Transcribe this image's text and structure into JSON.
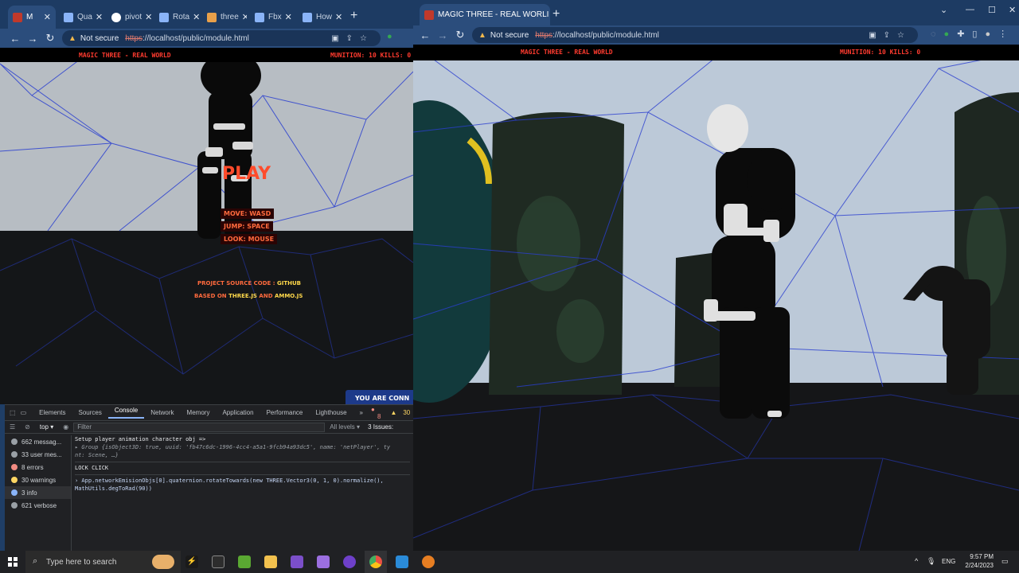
{
  "left_window": {
    "tabs": [
      {
        "label": "M",
        "color": "#c0392b"
      },
      {
        "label": "Qua",
        "color": "#8ab4f8"
      },
      {
        "label": "pivot",
        "color": "#ffffff"
      },
      {
        "label": "Rota",
        "color": "#8ab4f8"
      },
      {
        "label": "three",
        "color": "#e8a04a"
      },
      {
        "label": "Fbx",
        "color": "#8ab4f8"
      },
      {
        "label": "How",
        "color": "#8ab4f8"
      }
    ],
    "security": "Not secure",
    "url_scheme": "https",
    "url_rest": "://localhost/public/module.html",
    "hud_title": "MAGIC THREE - REAL WORLD",
    "hud_stats": "MUNITION: 10 KILLS: 0",
    "play_label": "PLAY",
    "controls": [
      "MOVE: WASD",
      "JUMP: SPACE",
      "LOOK: MOUSE"
    ],
    "source_prefix": "PROJECT SOURCE CODE :",
    "source_link": "GITHUB",
    "based_prefix": "BASED ON",
    "based_link_1": "THREE.JS",
    "based_and": "AND",
    "based_link_2": "AMMO.JS",
    "notice": "YOU ARE CONN"
  },
  "devtools": {
    "tabs": [
      "Elements",
      "Sources",
      "Console",
      "Network",
      "Memory",
      "Application",
      "Performance",
      "Lighthouse",
      "»"
    ],
    "active_tab": "Console",
    "errors_badge": "8",
    "warnings_badge": "30",
    "context": "top",
    "filter_placeholder": "Filter",
    "levels": "All levels",
    "issues": "3 Issues:",
    "sidebar": [
      {
        "label": "662 messag...",
        "color": "#9aa0a6"
      },
      {
        "label": "33 user mes...",
        "color": "#9aa0a6"
      },
      {
        "label": "8 errors",
        "color": "#f28b82"
      },
      {
        "label": "30 warnings",
        "color": "#fdd663"
      },
      {
        "label": "3 info",
        "color": "#8ab4f8"
      },
      {
        "label": "621 verbose",
        "color": "#9aa0a6"
      }
    ],
    "log": [
      "Setup player animation character obj =>",
      "▸ Group {isObject3D: true, uuid: 'fb47c6dc-1996-4cc4-a5a1-9fcb94a93dc5', name: 'netPlayer', ty",
      "   nt: Scene, …}",
      "LOCK CLICK",
      "› App.networkEmisionObjs[0].quaternion.rotateTowards(new THREE.Vector3(0, 1, 0).normalize(),",
      "   MathUtils.degToRad(90))"
    ]
  },
  "right_window": {
    "tab_title": "MAGIC THREE - REAL WORLI",
    "security": "Not secure",
    "url_scheme": "https",
    "url_rest": "://localhost/public/module.html",
    "hud_title": "MAGIC THREE - REAL WORLD",
    "hud_stats": "MUNITION: 10 KILLS: 0"
  },
  "taskbar": {
    "search_placeholder": "Type here to search",
    "language": "ENG",
    "time": "9:57 PM",
    "date": "2/24/2023"
  }
}
